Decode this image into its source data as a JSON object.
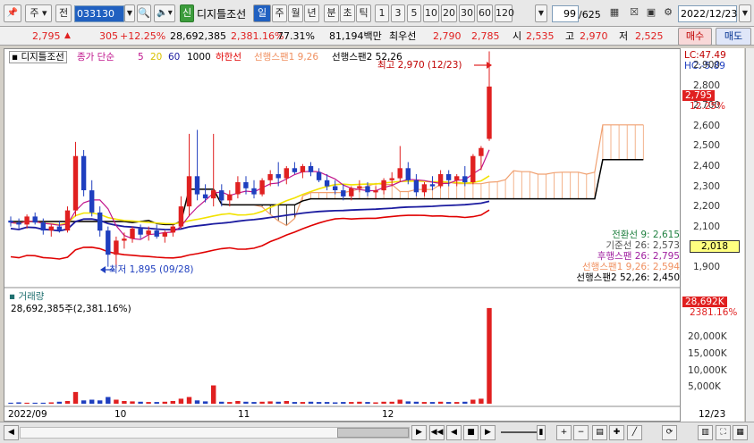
{
  "toolbar": {
    "market_label": "주",
    "mode_label": "전",
    "code_value": "033130",
    "sin_label": "신",
    "stock_name": "디지틀조선",
    "period_day": "일",
    "period_week": "주",
    "period_month": "월",
    "period_year": "년",
    "period_min": "분",
    "period_sec": "초",
    "period_tick": "틱",
    "intervals": [
      "1",
      "3",
      "5",
      "10",
      "20",
      "30",
      "60",
      "120"
    ],
    "count_value": "99",
    "count_total": "/625",
    "date_value": "2022/12/23"
  },
  "quote": {
    "price": "2,795",
    "arrow": "▲",
    "change": "305",
    "change_pct": "+12.25%",
    "volume": "28,692,385",
    "volume_ratio": "2,381.16%",
    "turnover": "77.31%",
    "amount": "81,194백만",
    "bid_label": "최우선",
    "bid": "2,790",
    "ask": "2,785",
    "open_label": "시",
    "open": "2,535",
    "high_label": "고",
    "high": "2,970",
    "low_label": "저",
    "low": "2,525",
    "buy_label": "매수",
    "sell_label": "매도"
  },
  "legend": {
    "name": "디지틀조선",
    "ma_label": "종가 단순",
    "ma5": "5",
    "ma20": "20",
    "ma60": "60",
    "ma1000": "1000",
    "lower": "하한선",
    "span1": "선행스팬1 9,26",
    "span2": "선행스팬2 52,26"
  },
  "annotations": {
    "high": "최고 2,970 (12/23)",
    "low": "최저 1,895 (09/28)"
  },
  "ichimoku": {
    "tenkan": "전환선 9: 2,615",
    "kijun": "기준선 26: 2,573",
    "chikou": "후행스팬 26: 2,795",
    "span1": "선행스팬1 9,26: 2,594",
    "span2": "선행스팬2 52,26: 2,450"
  },
  "price_axis": {
    "lc": "LC:47.49",
    "hc": "HC:-5.89",
    "ticks": [
      "2,900",
      "2,800",
      "2,700",
      "2,600",
      "2,500",
      "2,400",
      "2,300",
      "2,200",
      "2,100",
      "2,000",
      "1,900"
    ],
    "current": "2,795",
    "current_pct": "12.25%",
    "cursor": "2,018"
  },
  "volume_panel": {
    "title": "거래량",
    "value": "28,692,385주(2,381.16%)",
    "current": "28,692K",
    "current_pct": "2381.16%",
    "ticks": [
      "20,000K",
      "15,000K",
      "10,000K",
      "5,000K"
    ]
  },
  "x_axis": {
    "labels": [
      "2022/09",
      "10",
      "11",
      "12",
      "12/23"
    ]
  },
  "colors": {
    "up": "#e02020",
    "down": "#1f3fbf",
    "ma5": "#c0148c",
    "ma20": "#f2e200",
    "ma60": "#1c1ca0",
    "lower": "#e00000",
    "span1": "#f0a070",
    "span2": "#000000"
  },
  "chart_data": {
    "type": "candlestick",
    "ylim": [
      1850,
      2950
    ],
    "candles": [
      [
        2130,
        2150,
        2100,
        2120
      ],
      [
        2120,
        2140,
        2090,
        2110
      ],
      [
        2110,
        2160,
        2090,
        2150
      ],
      [
        2150,
        2170,
        2110,
        2120
      ],
      [
        2120,
        2140,
        2060,
        2080
      ],
      [
        2080,
        2110,
        2050,
        2100
      ],
      [
        2100,
        2130,
        2070,
        2080
      ],
      [
        2080,
        2200,
        2070,
        2180
      ],
      [
        2180,
        2520,
        2150,
        2450
      ],
      [
        2450,
        2480,
        2250,
        2280
      ],
      [
        2280,
        2330,
        2150,
        2170
      ],
      [
        2170,
        2200,
        2050,
        2080
      ],
      [
        2080,
        2100,
        1900,
        1960
      ],
      [
        1960,
        2050,
        1895,
        2030
      ],
      [
        2030,
        2070,
        1990,
        2040
      ],
      [
        2040,
        2100,
        2020,
        2090
      ],
      [
        2090,
        2110,
        2040,
        2060
      ],
      [
        2060,
        2100,
        2030,
        2080
      ],
      [
        2080,
        2110,
        2040,
        2050
      ],
      [
        2050,
        2080,
        2020,
        2070
      ],
      [
        2070,
        2110,
        2050,
        2100
      ],
      [
        2100,
        2250,
        2090,
        2200
      ],
      [
        2200,
        2560,
        2150,
        2350
      ],
      [
        2350,
        2580,
        2230,
        2260
      ],
      [
        2260,
        2310,
        2220,
        2240
      ],
      [
        2240,
        2560,
        2200,
        2280
      ],
      [
        2280,
        2310,
        2200,
        2230
      ],
      [
        2230,
        2280,
        2200,
        2260
      ],
      [
        2260,
        2350,
        2240,
        2320
      ],
      [
        2320,
        2350,
        2260,
        2290
      ],
      [
        2290,
        2330,
        2240,
        2260
      ],
      [
        2260,
        2340,
        2250,
        2330
      ],
      [
        2330,
        2380,
        2300,
        2360
      ],
      [
        2360,
        2420,
        2300,
        2340
      ],
      [
        2340,
        2400,
        2310,
        2390
      ],
      [
        2390,
        2420,
        2360,
        2370
      ],
      [
        2370,
        2410,
        2340,
        2400
      ],
      [
        2400,
        2420,
        2350,
        2370
      ],
      [
        2370,
        2390,
        2320,
        2330
      ],
      [
        2330,
        2360,
        2280,
        2300
      ],
      [
        2300,
        2330,
        2260,
        2280
      ],
      [
        2280,
        2310,
        2230,
        2250
      ],
      [
        2250,
        2300,
        2230,
        2290
      ],
      [
        2290,
        2330,
        2270,
        2300
      ],
      [
        2300,
        2320,
        2250,
        2270
      ],
      [
        2270,
        2300,
        2240,
        2280
      ],
      [
        2280,
        2340,
        2260,
        2330
      ],
      [
        2330,
        2370,
        2300,
        2340
      ],
      [
        2340,
        2500,
        2320,
        2390
      ],
      [
        2390,
        2420,
        2310,
        2330
      ],
      [
        2330,
        2360,
        2250,
        2270
      ],
      [
        2270,
        2320,
        2250,
        2310
      ],
      [
        2310,
        2350,
        2280,
        2300
      ],
      [
        2300,
        2380,
        2290,
        2360
      ],
      [
        2360,
        2380,
        2300,
        2330
      ],
      [
        2330,
        2360,
        2300,
        2350
      ],
      [
        2350,
        2400,
        2300,
        2320
      ],
      [
        2320,
        2460,
        2310,
        2450
      ],
      [
        2450,
        2500,
        2380,
        2490
      ],
      [
        2535,
        2970,
        2525,
        2795
      ]
    ],
    "volumes": [
      0.3,
      0.4,
      0.3,
      0.3,
      0.3,
      0.4,
      0.6,
      0.8,
      3.5,
      1.0,
      1.2,
      1.0,
      2.0,
      1.2,
      0.8,
      0.7,
      0.6,
      0.5,
      0.5,
      0.6,
      0.8,
      1.5,
      2.0,
      1.0,
      0.7,
      5.5,
      0.6,
      0.5,
      0.8,
      0.6,
      0.5,
      0.6,
      0.7,
      0.6,
      0.8,
      0.5,
      0.5,
      0.6,
      0.5,
      0.5,
      0.4,
      0.5,
      0.5,
      0.6,
      0.5,
      0.4,
      0.6,
      0.6,
      1.2,
      0.7,
      0.6,
      0.5,
      0.5,
      0.6,
      0.5,
      0.5,
      0.6,
      1.2,
      1.5,
      28.7
    ]
  }
}
